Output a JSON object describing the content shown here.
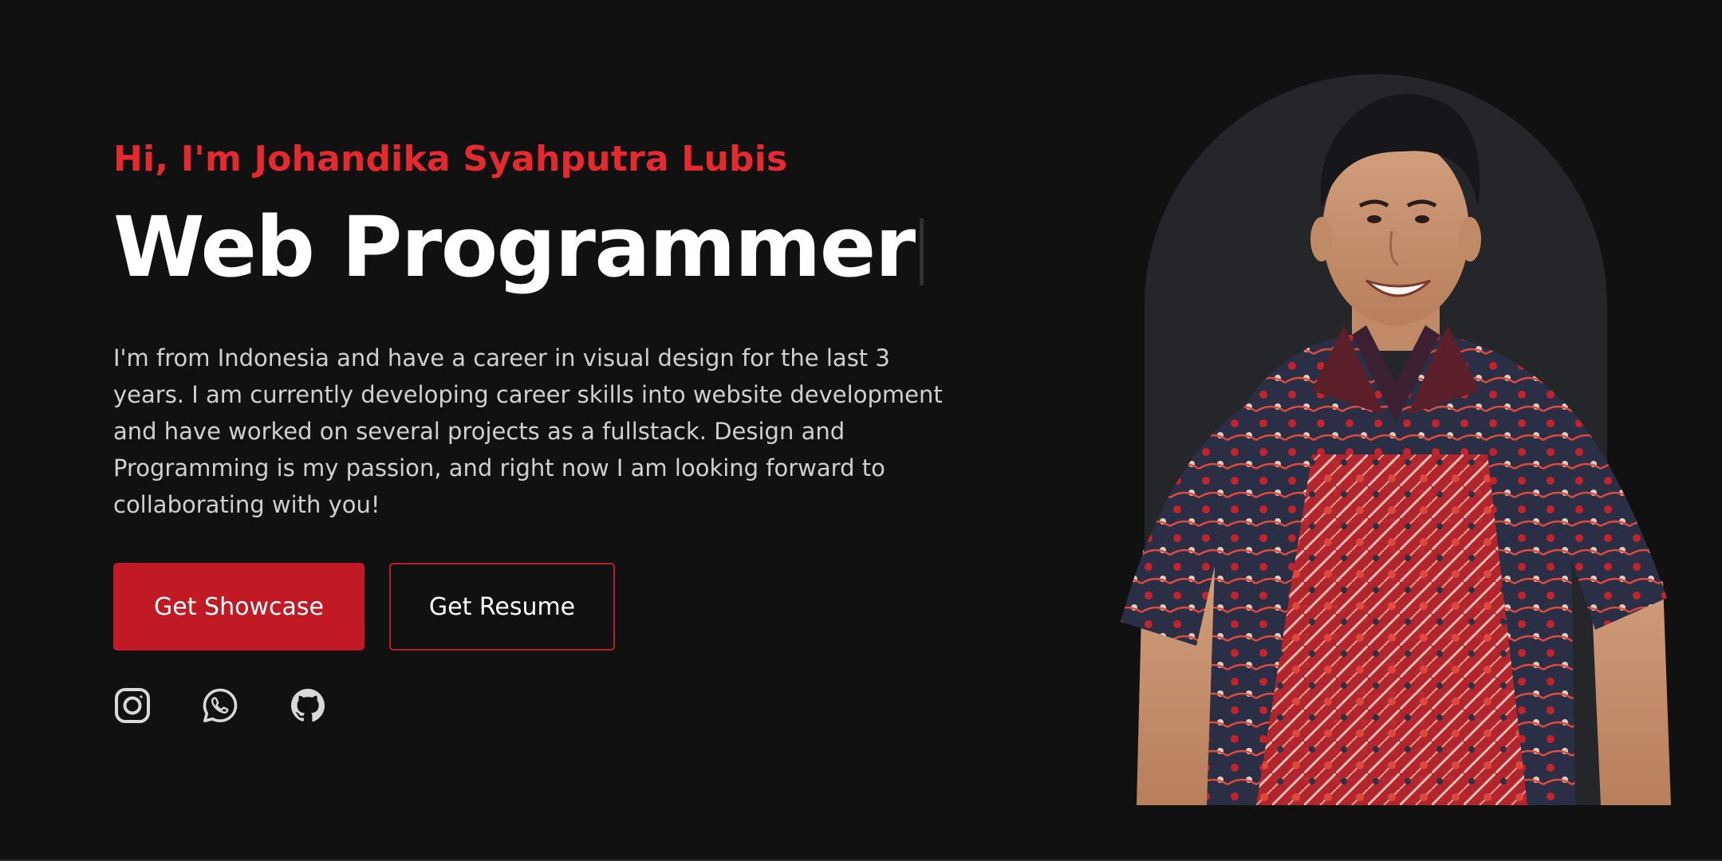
{
  "hero": {
    "greeting": "Hi, I'm Johandika Syahputra Lubis",
    "headline": "Web Programmer",
    "bio": "I'm from Indonesia and have a career in visual design for the last 3 years. I am currently developing career skills into website development and have worked on several projects as a fullstack. Design and Programming is my passion, and right now I am looking forward to collaborating with you!",
    "primary_button": "Get Showcase",
    "secondary_button": "Get Resume"
  },
  "socials": [
    {
      "icon": "instagram-icon"
    },
    {
      "icon": "whatsapp-icon"
    },
    {
      "icon": "github-icon"
    }
  ],
  "colors": {
    "background": "#111112",
    "accent": "#e52a2f",
    "button_primary": "#c21a24",
    "arch": "#24262a"
  }
}
